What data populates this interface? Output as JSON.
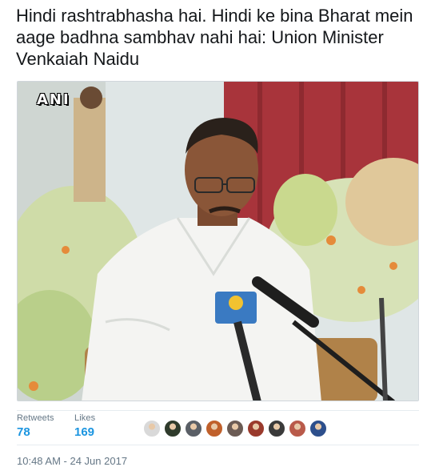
{
  "tweet": {
    "text": "Hindi rashtrabhasha hai. Hindi ke bina Bharat mein aage badhna sambhav nahi hai: Union Minister Venkaiah Naidu"
  },
  "media": {
    "watermark": "ANI"
  },
  "stats": {
    "retweets_label": "Retweets",
    "retweets_count": "78",
    "likes_label": "Likes",
    "likes_count": "169"
  },
  "liked_by": [
    {
      "icon": "avatar-photo-icon",
      "color": "#d9d9d9"
    },
    {
      "icon": "avatar-photo-icon",
      "color": "#2f3b2c"
    },
    {
      "icon": "avatar-photo-icon",
      "color": "#5a5f66"
    },
    {
      "icon": "avatar-photo-icon",
      "color": "#c0602b"
    },
    {
      "icon": "avatar-photo-icon",
      "color": "#6b5b54"
    },
    {
      "icon": "avatar-photo-icon",
      "color": "#9a3a2c"
    },
    {
      "icon": "avatar-photo-icon",
      "color": "#3a3a3a"
    },
    {
      "icon": "avatar-photo-icon",
      "color": "#b95a4a"
    },
    {
      "icon": "avatar-photo-icon",
      "color": "#2d4f8c"
    }
  ],
  "timestamp": "10:48 AM - 24 Jun 2017",
  "colors": {
    "link_blue": "#1b95e0",
    "secondary_text": "#657786",
    "divider": "#e6ecf0"
  }
}
